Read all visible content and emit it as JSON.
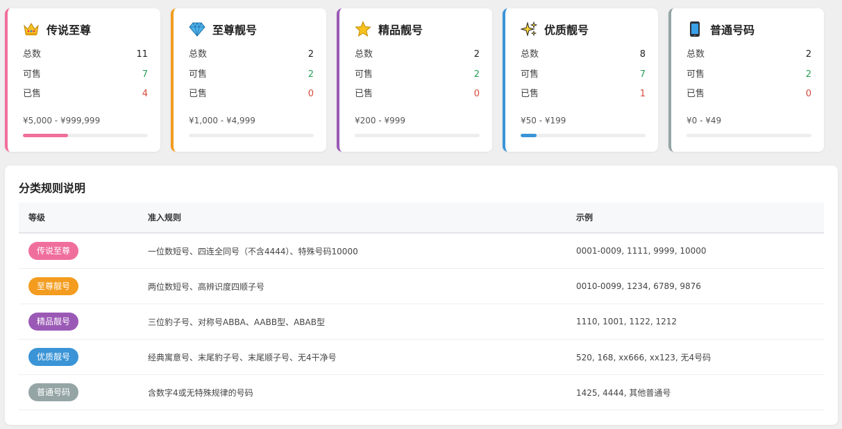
{
  "cards": [
    {
      "name": "传说至尊",
      "icon": "crown-icon",
      "color": "#f06e9c",
      "stats": [
        {
          "label": "总数",
          "value": "11"
        },
        {
          "label": "可售",
          "value": "7"
        },
        {
          "label": "已售",
          "value": "4"
        }
      ],
      "price": "¥5,000 - ¥999,999",
      "sold_fraction": 0.36
    },
    {
      "name": "至尊靓号",
      "icon": "diamond-icon",
      "color": "#f39c1f",
      "stats": [
        {
          "label": "总数",
          "value": "2"
        },
        {
          "label": "可售",
          "value": "2"
        },
        {
          "label": "已售",
          "value": "0"
        }
      ],
      "price": "¥1,000 - ¥4,999",
      "sold_fraction": 0
    },
    {
      "name": "精品靓号",
      "icon": "star-icon",
      "color": "#9b59b6",
      "stats": [
        {
          "label": "总数",
          "value": "2"
        },
        {
          "label": "可售",
          "value": "2"
        },
        {
          "label": "已售",
          "value": "0"
        }
      ],
      "price": "¥200 - ¥999",
      "sold_fraction": 0
    },
    {
      "name": "优质靓号",
      "icon": "sparkles-icon",
      "color": "#3a94d6",
      "stats": [
        {
          "label": "总数",
          "value": "8"
        },
        {
          "label": "可售",
          "value": "7"
        },
        {
          "label": "已售",
          "value": "1"
        }
      ],
      "price": "¥50 - ¥199",
      "sold_fraction": 0.125
    },
    {
      "name": "普通号码",
      "icon": "phone-icon",
      "color": "#95a5a6",
      "stats": [
        {
          "label": "总数",
          "value": "2"
        },
        {
          "label": "可售",
          "value": "2"
        },
        {
          "label": "已售",
          "value": "0"
        }
      ],
      "price": "¥0 - ¥49",
      "sold_fraction": 0
    }
  ],
  "rules": {
    "title": "分类规则说明",
    "headers": [
      "等级",
      "准入规则",
      "示例"
    ],
    "rows": [
      {
        "tag": "传说至尊",
        "color": "#f06e9c",
        "rule": "一位数短号、四连全同号（不含4444）、特殊号码10000",
        "example": "0001-0009, 1111, 9999, 10000"
      },
      {
        "tag": "至尊靓号",
        "color": "#f39c1f",
        "rule": "两位数短号、高辨识度四顺子号",
        "example": "0010-0099, 1234, 6789, 9876"
      },
      {
        "tag": "精品靓号",
        "color": "#9b59b6",
        "rule": "三位豹子号、对称号ABBA、AABB型、ABAB型",
        "example": "1110, 1001, 1122, 1212"
      },
      {
        "tag": "优质靓号",
        "color": "#3a94d6",
        "rule": "经典寓意号、末尾豹子号、末尾顺子号、无4干净号",
        "example": "520, 168, xx666, xx123, 无4号码"
      },
      {
        "tag": "普通号码",
        "color": "#95a5a6",
        "rule": "含数字4或无特殊规律的号码",
        "example": "1425, 4444, 其他普通号"
      }
    ]
  }
}
